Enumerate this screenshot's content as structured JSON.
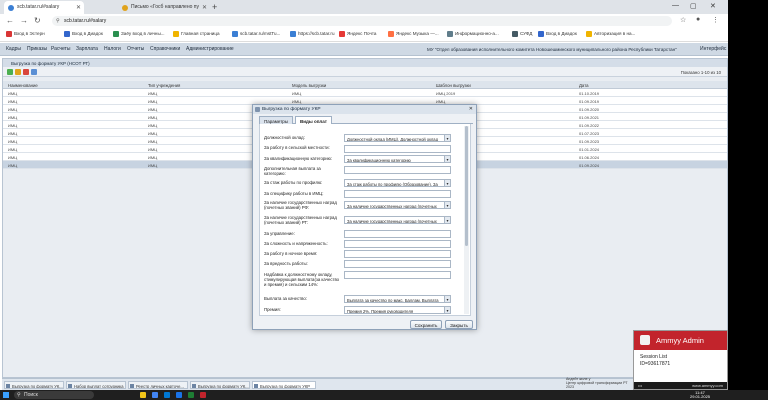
{
  "browser": {
    "tabs": [
      {
        "label": "scb.tatar.ru/#salary",
        "active": true
      },
      {
        "label": "Письмо «Госб направлено пу",
        "active": false
      }
    ],
    "url": "scb.tatar.ru/#salary",
    "bookmarks": [
      "Вход в Эстерн",
      "Вход в Диадок",
      "Заёу вход в личны...",
      "Главная страница",
      "scb.tatar.ru/mstTu...",
      "https://scb.tatar.ru",
      "Яндекс Почта",
      "Яндекс Музыка —...",
      "Информационно-а...",
      "СУФД",
      "Вход в Диадок",
      "Авторизация в на..."
    ]
  },
  "app_menu": {
    "items": [
      "Кадры",
      "Приказы",
      "Расчеты",
      "Зарплата",
      "Налоги",
      "Отчеты",
      "Справочники",
      "Администрирование"
    ],
    "org": "МУ \"Отдел образования исполнительного комитета Новошешминского муниципального района Республики Татарстан\"",
    "interface": "Интерфейс"
  },
  "panel": {
    "title": "Выгрузка по формату УКР (НСОТ РТ)",
    "shown": "Показано 1-10 из 10",
    "columns": [
      "Наименование",
      "Тип учреждения",
      "Модель выгрузки",
      "Шаблон выгрузки",
      "Дата"
    ],
    "rows": [
      [
        "ИМЦ",
        "ИМЦ",
        "ИМЦ",
        "ИМЦ 2019",
        "01.10.2019"
      ],
      [
        "ИМЦ",
        "ИМЦ",
        "ИМЦ",
        "ИМЦ",
        "01.09.2019"
      ],
      [
        "ИМЦ",
        "ИМЦ",
        "ИМЦ",
        "ИМЦ",
        "01.09.2020"
      ],
      [
        "ИМЦ",
        "ИМЦ",
        "ИМЦ",
        "ИМЦ",
        "01.09.2021"
      ],
      [
        "ИМЦ",
        "ИМЦ",
        "ИМЦ",
        "ИМЦ",
        "01.09.2022"
      ],
      [
        "ИМЦ",
        "ИМЦ",
        "ИМЦ",
        "ИМЦ",
        "01.07.2023"
      ],
      [
        "ИМЦ",
        "ИМЦ",
        "ИМЦ",
        "ИМЦ",
        "01.09.2023"
      ],
      [
        "ИМЦ",
        "ИМЦ",
        "ИМЦ",
        "ИМЦ",
        "01.01.2024"
      ],
      [
        "ИМЦ",
        "ИМЦ",
        "ИМЦ",
        "ИМЦ",
        "01.06.2024"
      ],
      [
        "ИМЦ",
        "ИМЦ",
        "ИМЦ",
        "ИМЦ",
        "01.09.2024"
      ]
    ]
  },
  "dialog": {
    "title": "Выгрузка по формату УКР",
    "tabs": [
      "Параметры",
      "Виды оплат"
    ],
    "fields": [
      {
        "label": "Должностной оклад:",
        "value": "Должностной оклад (ИМЦ), Должностной оклад",
        "dropdown": true
      },
      {
        "label": "За работу в сельской местности:",
        "value": "",
        "dropdown": false
      },
      {
        "label": "За квалификационную категорию:",
        "value": "За квалификационную категорию",
        "dropdown": true
      },
      {
        "label": "Дополнительная выплата за категорию:",
        "value": "",
        "dropdown": false
      },
      {
        "label": "За стаж работы по профилю:",
        "value": "За стаж работы по профилю (Образование), За",
        "dropdown": true
      },
      {
        "label": "За специфику работы в ИМЦ:",
        "value": "",
        "dropdown": false
      },
      {
        "label": "За наличие государственных наград (почетных званий) РФ:",
        "value": "За наличие государственных наград (почетных",
        "dropdown": true
      },
      {
        "label": "За наличие государственных наград (почетных званий) РТ:",
        "value": "За наличие государственных наград (почетных",
        "dropdown": true
      },
      {
        "label": "За управление:",
        "value": "",
        "dropdown": false
      },
      {
        "label": "За сложность и напряженность:",
        "value": "",
        "dropdown": false
      },
      {
        "label": "За работу в ночное время:",
        "value": "",
        "dropdown": false
      },
      {
        "label": "За вредность работы:",
        "value": "",
        "dropdown": false
      },
      {
        "label": "Надбавка к должностному окладу, стимулирующая выплата(за качество и премия) и сельским 14%:",
        "value": "",
        "dropdown": false
      },
      {
        "label": "Выплата за качество:",
        "value": "Выплата за качество по макс. Баллам, Выплата",
        "dropdown": true
      },
      {
        "label": "Премия:",
        "value": "Премия 2%, Премия руководителя",
        "dropdown": true
      }
    ],
    "save": "Сохранить",
    "close": "Закрыть"
  },
  "app_tasks": [
    {
      "label": "Выгрузка по формату УК...",
      "active": false
    },
    {
      "label": "Набор выплат сотрудника",
      "active": false
    },
    {
      "label": "Реестр личных карточе...",
      "active": false
    },
    {
      "label": "Выгрузка по формату УК...",
      "active": false
    },
    {
      "label": "Выгрузка по формату УКР",
      "active": true
    }
  ],
  "sys_msg": [
    "Апдейт жиле у",
    "Центр цифровой трансформации РТ",
    "2023"
  ],
  "ammyy": {
    "title": "Ammyy Admin",
    "session": "Session List",
    "id": "ID=93617871",
    "site": "www.ammyy.com",
    "accent": "#c2242c"
  },
  "taskbar": {
    "search": "Поиск",
    "time": "11:47",
    "date": "29.01.2025"
  }
}
